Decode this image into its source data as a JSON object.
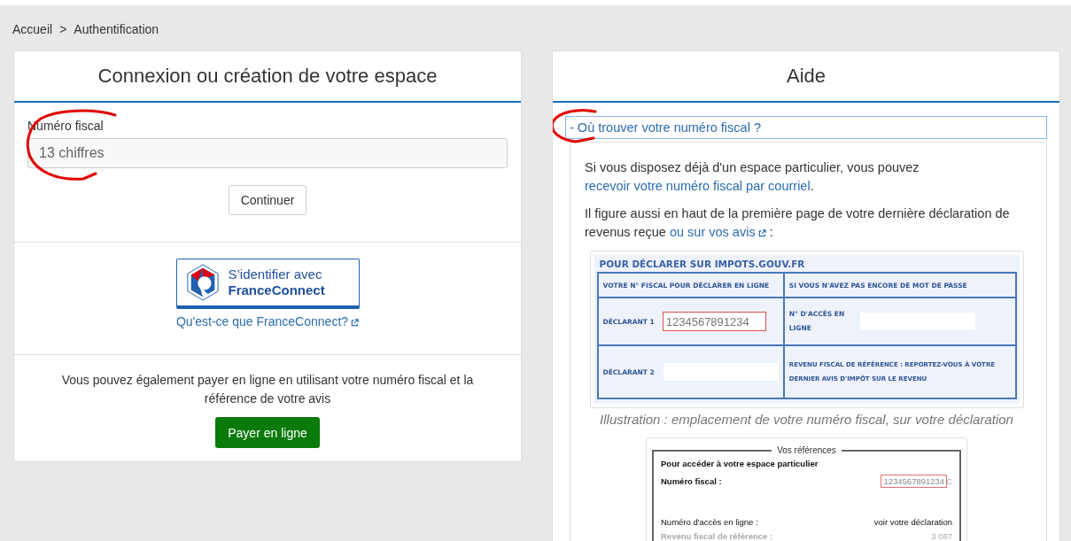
{
  "breadcrumb": {
    "items": [
      {
        "label": "Accueil"
      },
      {
        "label": "Authentification"
      }
    ],
    "separator": ">"
  },
  "login_panel": {
    "title": "Connexion ou création de votre espace",
    "field": {
      "label": "Numéro fiscal",
      "placeholder": "13 chiffres"
    },
    "continue_button": "Continuer",
    "franceconnect": {
      "button_line_1": "S’identifier avec",
      "button_line_2": "FranceConnect",
      "link": "Qu'est-ce que FranceConnect?"
    },
    "payment": {
      "text": "Vous pouvez également payer en ligne en utilisant votre numéro fiscal et la référence de votre avis",
      "button": "Payer en ligne"
    }
  },
  "help_panel": {
    "title": "Aide",
    "accordion": {
      "toggle_sign": "-",
      "title": "Où trouver votre numéro fiscal ?",
      "expanded": true
    },
    "paragraphs": [
      [
        {
          "kind": "text",
          "text": "Si vous disposez déjà d'un espace particulier, vous pouvez "
        },
        {
          "kind": "link",
          "text": "recevoir votre numéro fiscal par courriel"
        },
        {
          "kind": "text",
          "text": "."
        }
      ],
      [
        {
          "kind": "text",
          "text": "Il figure aussi en haut de la première page de votre dernière déclaration de revenus reçue "
        },
        {
          "kind": "external_link",
          "text": "ou sur vos avis"
        },
        {
          "kind": "text",
          "text": " :"
        }
      ]
    ],
    "declaration_form": {
      "title": "POUR DÉCLARER SUR IMPOTS.GOUV.FR",
      "column_headers": [
        "VOTRE N° FISCAL POUR DÉCLARER EN LIGNE",
        "SI VOUS N'AVEZ PAS ENCORE DE MOT DE PASSE"
      ],
      "rows": [
        {
          "label": "DÉCLARANT 1",
          "value": "1234567891234",
          "highlighted": true,
          "right_label": "N° D'ACCÈS EN LIGNE",
          "kind": "field"
        },
        {
          "label": "DÉCLARANT 2",
          "value": "",
          "highlighted": false,
          "right_label": "REVENU FISCAL DE RÉFÉRENCE : REPORTEZ-VOUS À VOTRE DERNIER AVIS D'IMPÔT SUR LE REVENU",
          "kind": "note"
        }
      ]
    },
    "caption": "Illustration : emplacement de votre numéro fiscal, sur votre déclaration",
    "references": {
      "legend": "Vos références",
      "heading": "Pour accéder à votre espace particulier",
      "rows": [
        {
          "label": "Numéro fiscal :",
          "value": "1234567891234",
          "suffix": "C",
          "highlighted": true,
          "faded": false
        },
        {
          "label": "Numéro d'accès en ligne :",
          "value": "voir votre déclaration",
          "suffix": "",
          "highlighted": false,
          "faded": false
        },
        {
          "label": "Revenu fiscal de référence :",
          "value": "3 087",
          "suffix": "",
          "highlighted": false,
          "faded": true
        }
      ]
    }
  }
}
